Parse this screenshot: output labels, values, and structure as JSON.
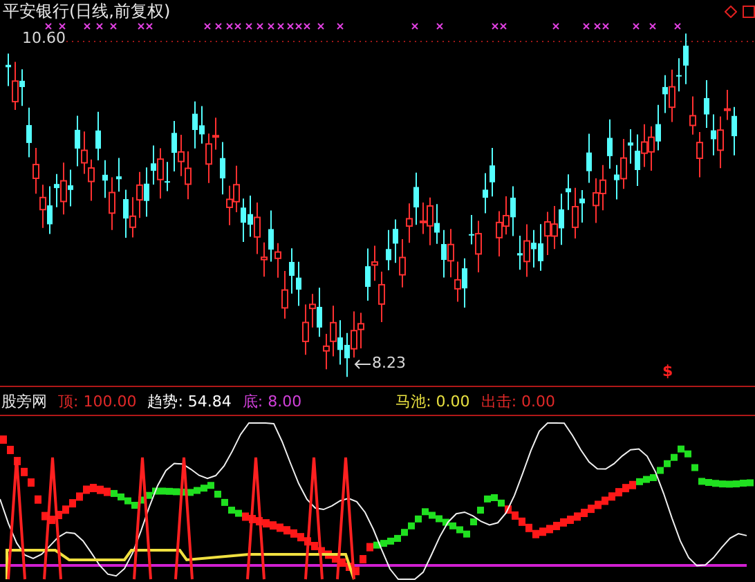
{
  "chart": {
    "title": "平安银行(日线,前复权)",
    "high_label": "10.60",
    "low_label": "8.23",
    "signal": "$"
  },
  "indicator": {
    "name": "股旁网",
    "groups": [
      [
        {
          "text": "顶: 100.00",
          "color": "#e02828"
        },
        {
          "text": "趋势: 54.84",
          "color": "#ffffff"
        },
        {
          "text": "底: 8.00",
          "color": "#d040d8"
        }
      ],
      [
        {
          "text": "马池: 0.00",
          "color": "#e8e040"
        },
        {
          "text": "出击: 0.00",
          "color": "#e02828"
        }
      ]
    ]
  }
}
